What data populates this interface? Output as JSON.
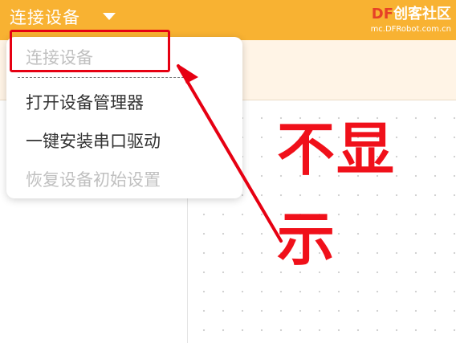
{
  "topbar": {
    "title": "连接设备",
    "logo_brand_prefix": "DF",
    "logo_brand_suffix": "创客社区",
    "logo_url": "mc.DFRobot.com.cn",
    "color": "#f8b232"
  },
  "dropdown": {
    "items": [
      {
        "label": "连接设备",
        "disabled": true
      },
      {
        "label": "打开设备管理器",
        "disabled": false
      },
      {
        "label": "一键安装串口驱动",
        "disabled": false
      },
      {
        "label": "恢复设备初始设置",
        "disabled": true
      }
    ]
  },
  "annotation": {
    "line1": "不显",
    "line2": "示",
    "color": "#f0101a"
  },
  "icons": {
    "dropdown_caret": "caret-down-icon",
    "annotation_arrow": "arrow-icon"
  }
}
